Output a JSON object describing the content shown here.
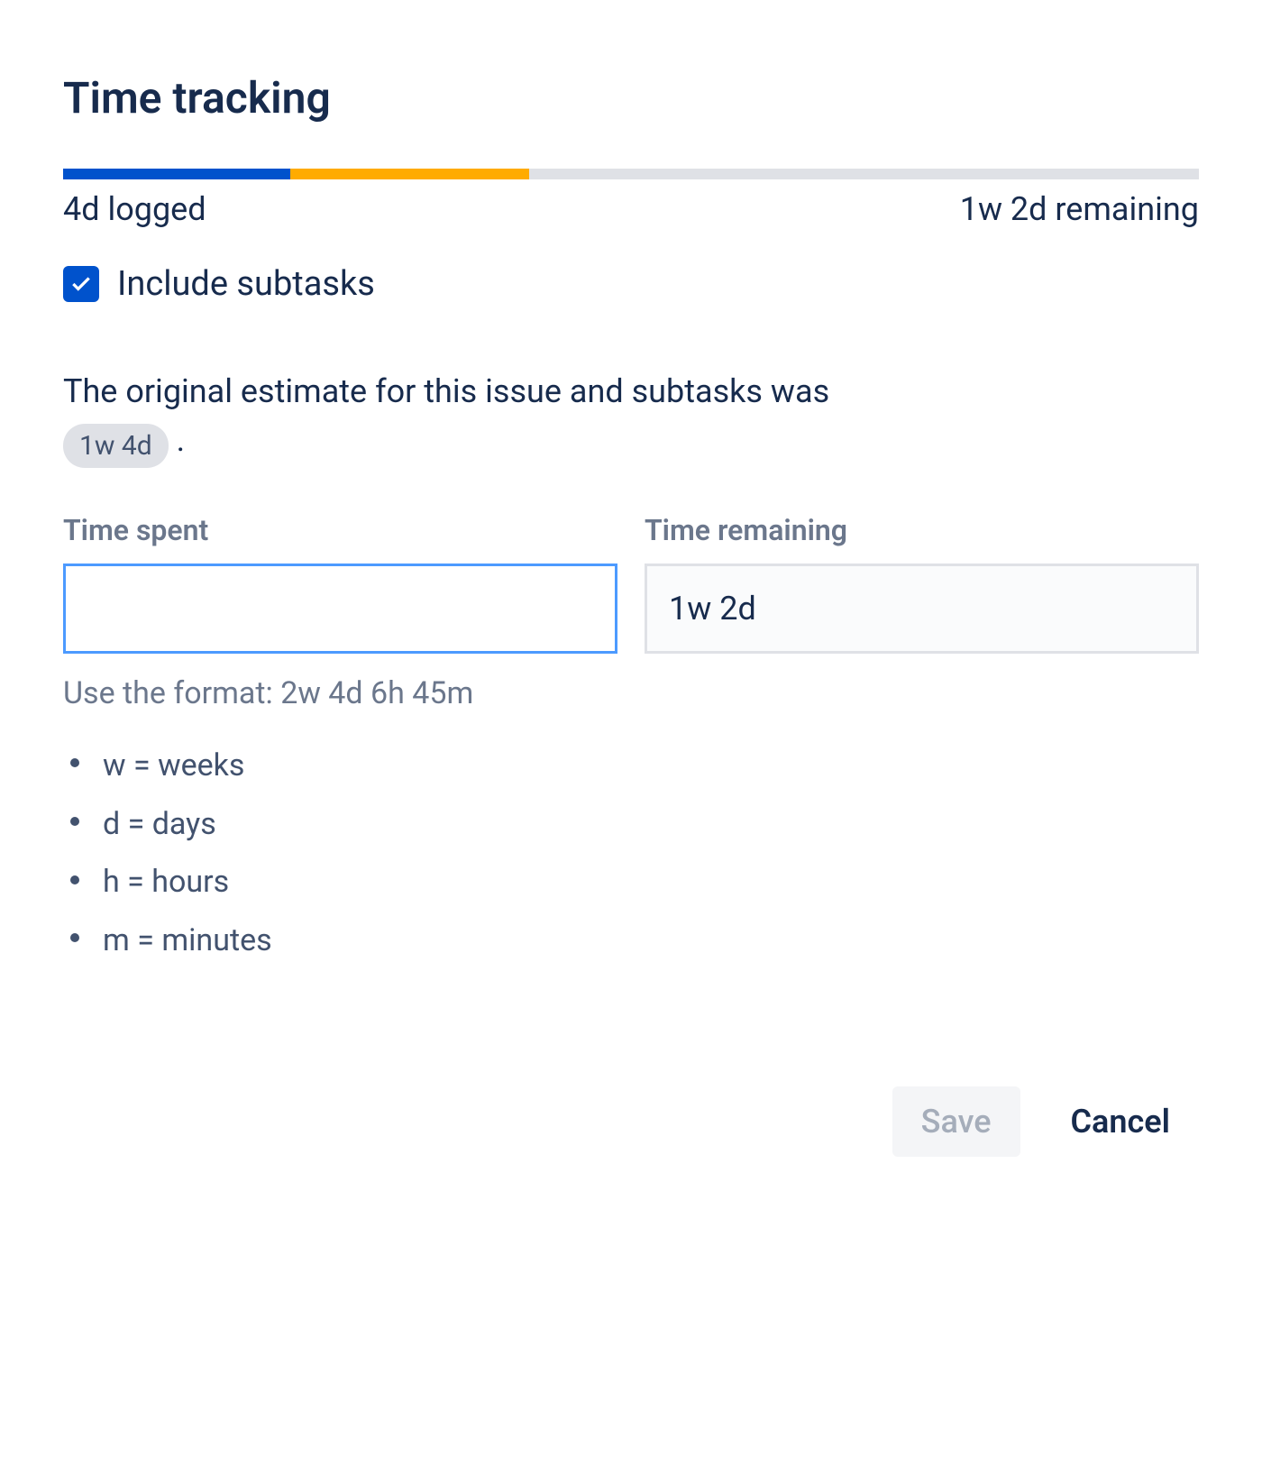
{
  "dialog": {
    "title": "Time tracking"
  },
  "progress": {
    "logged_label": "4d logged",
    "remaining_label": "1w 2d remaining",
    "logged_percent": 20,
    "estimate_percent": 21
  },
  "checkbox": {
    "label": "Include subtasks",
    "checked": true
  },
  "estimate": {
    "prefix": "The original estimate for this issue and subtasks was",
    "badge": "1w 4d",
    "suffix": "."
  },
  "fields": {
    "time_spent": {
      "label": "Time spent",
      "value": ""
    },
    "time_remaining": {
      "label": "Time remaining",
      "value": "1w 2d"
    }
  },
  "hint": {
    "text": "Use the format: 2w 4d 6h 45m",
    "legend": [
      "w = weeks",
      "d = days",
      "h = hours",
      "m = minutes"
    ]
  },
  "buttons": {
    "save": "Save",
    "cancel": "Cancel"
  }
}
